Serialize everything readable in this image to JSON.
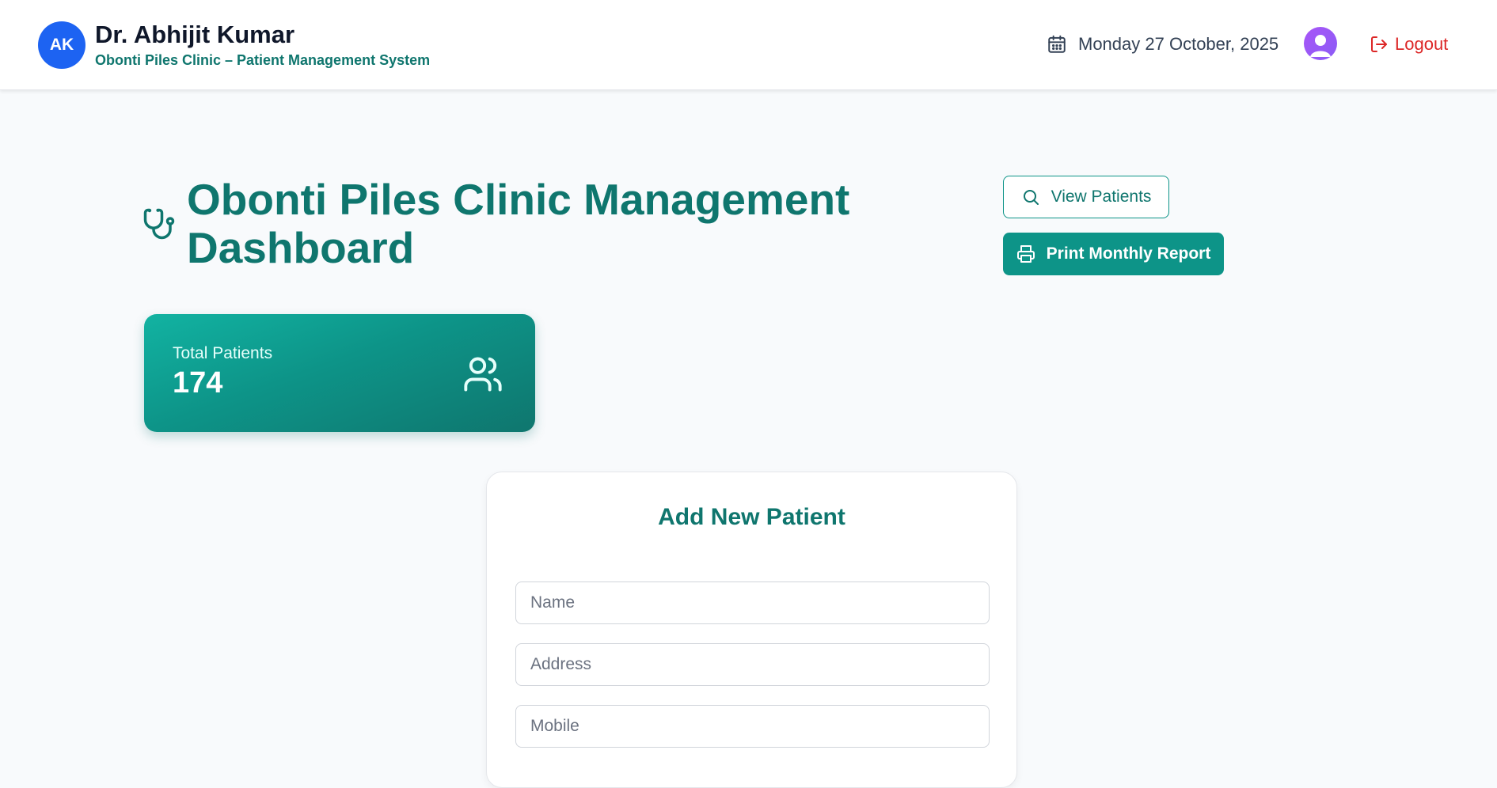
{
  "header": {
    "initials": "AK",
    "doctor_name": "Dr. Abhijit Kumar",
    "clinic_subtitle": "Obonti Piles Clinic – Patient Management System",
    "date": "Monday 27 October, 2025",
    "logout_label": "Logout"
  },
  "page": {
    "title": "Obonti Piles Clinic Management Dashboard",
    "view_patients_label": "View Patients",
    "print_report_label": "Print Monthly Report"
  },
  "stats": {
    "total_patients_label": "Total Patients",
    "total_patients_value": "174"
  },
  "form": {
    "title": "Add New Patient",
    "name_placeholder": "Name",
    "address_placeholder": "Address",
    "mobile_placeholder": "Mobile"
  },
  "colors": {
    "primary": "#0d9488",
    "primary_dark": "#0f766e",
    "avatar_blue": "#1d63f2",
    "logout_red": "#dc2626"
  },
  "icons": {
    "date": "calendar-icon",
    "user": "user-avatar-icon",
    "logout": "logout-icon",
    "title": "stethoscope-icon",
    "view": "search-icon",
    "print": "printer-icon",
    "stat": "users-icon"
  }
}
